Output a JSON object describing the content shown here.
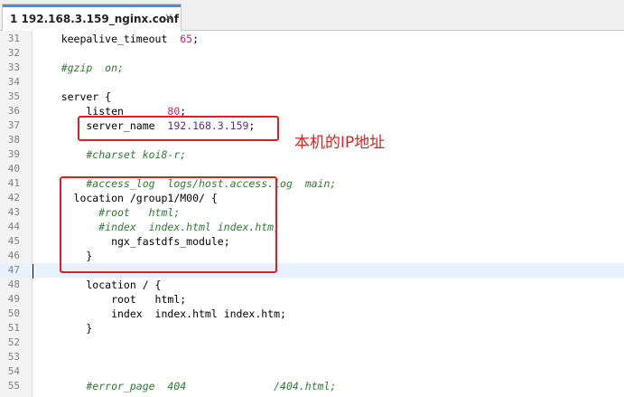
{
  "tab": {
    "index": "1",
    "title": "192.168.3.159_nginx.conf",
    "close_label": "×"
  },
  "annotation": "本机的IP地址",
  "lines": [
    {
      "n": "31",
      "parts": [
        [
          "",
          "    keepalive_timeout  "
        ],
        [
          "num",
          "65"
        ],
        [
          "",
          ";"
        ]
      ]
    },
    {
      "n": "32",
      "parts": []
    },
    {
      "n": "33",
      "parts": [
        [
          "cm",
          "    #gzip  on;"
        ]
      ]
    },
    {
      "n": "34",
      "parts": []
    },
    {
      "n": "35",
      "parts": [
        [
          "",
          "    server {"
        ]
      ]
    },
    {
      "n": "36",
      "parts": [
        [
          "",
          "        listen       "
        ],
        [
          "num",
          "80"
        ],
        [
          "",
          ";"
        ]
      ]
    },
    {
      "n": "37",
      "parts": [
        [
          "",
          "        server_name  "
        ],
        [
          "val",
          "192.168.3.159"
        ],
        [
          "",
          ";"
        ]
      ]
    },
    {
      "n": "38",
      "parts": []
    },
    {
      "n": "39",
      "parts": [
        [
          "cm",
          "        #charset koi8-r;"
        ]
      ]
    },
    {
      "n": "40",
      "parts": []
    },
    {
      "n": "41",
      "parts": [
        [
          "cm",
          "        #access_log  logs/host.access.log  main;"
        ]
      ]
    },
    {
      "n": "42",
      "parts": [
        [
          "",
          "      location /group1/M00/ {"
        ]
      ]
    },
    {
      "n": "43",
      "parts": [
        [
          "cm",
          "          #root   html;"
        ]
      ]
    },
    {
      "n": "44",
      "parts": [
        [
          "cm",
          "          #index  index.html index.htm;"
        ]
      ]
    },
    {
      "n": "45",
      "parts": [
        [
          "",
          "            ngx_fastdfs_module;"
        ]
      ]
    },
    {
      "n": "46",
      "parts": [
        [
          "",
          "        }"
        ]
      ]
    },
    {
      "n": "47",
      "parts": [],
      "current": true
    },
    {
      "n": "48",
      "parts": [
        [
          "",
          "        location / {"
        ]
      ]
    },
    {
      "n": "49",
      "parts": [
        [
          "",
          "            root   html;"
        ]
      ]
    },
    {
      "n": "50",
      "parts": [
        [
          "",
          "            index  index.html index.htm;"
        ]
      ]
    },
    {
      "n": "51",
      "parts": [
        [
          "",
          "        }"
        ]
      ]
    },
    {
      "n": "52",
      "parts": []
    },
    {
      "n": "53",
      "parts": []
    },
    {
      "n": "54",
      "parts": []
    },
    {
      "n": "55",
      "parts": [
        [
          "cm",
          "        #error_page  404              /404.html;"
        ]
      ]
    }
  ]
}
